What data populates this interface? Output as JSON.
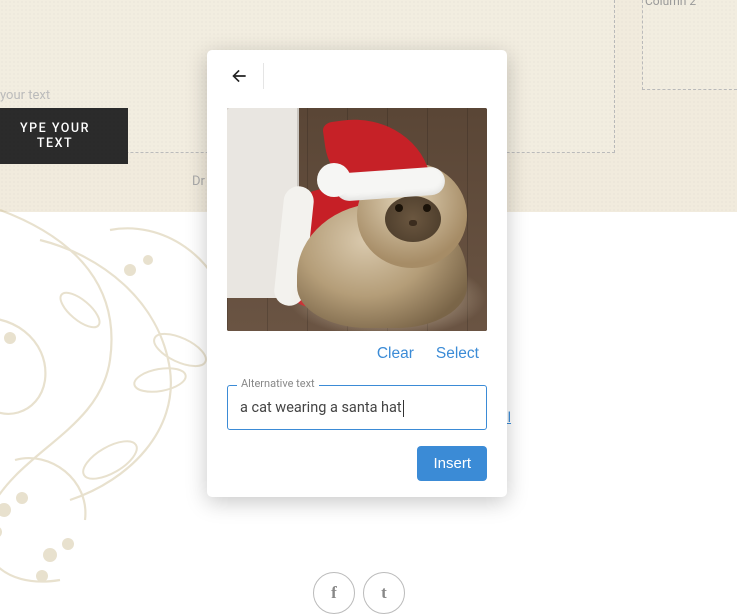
{
  "background": {
    "column2_label": "Column 2",
    "type_button": "YPE YOUR TEXT",
    "type_placeholder": "your text",
    "dropzone_text": "Dr",
    "link_fragment": "al"
  },
  "social": {
    "facebook_glyph": "f",
    "twitter_glyph": "t"
  },
  "modal": {
    "clear_label": "Clear",
    "select_label": "Select",
    "alt_label": "Alternative text",
    "alt_value": "a cat wearing a santa hat",
    "insert_label": "Insert"
  }
}
